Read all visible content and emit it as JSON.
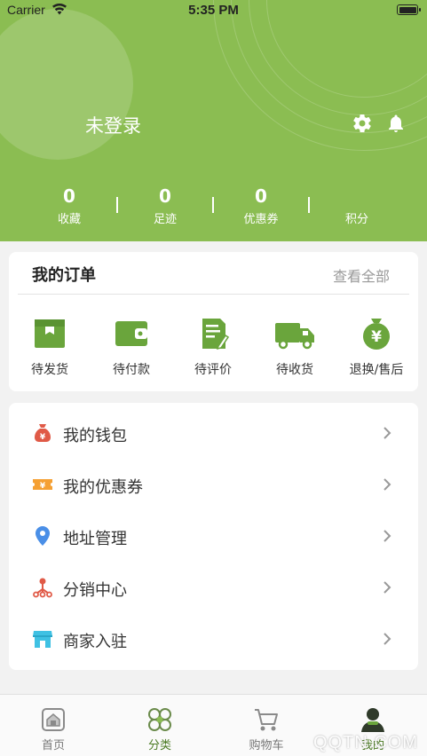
{
  "status_bar": {
    "carrier": "Carrier",
    "time": "5:35 PM"
  },
  "header": {
    "user_name": "未登录",
    "stats": [
      {
        "value": "0",
        "label": "收藏"
      },
      {
        "value": "0",
        "label": "足迹"
      },
      {
        "value": "0",
        "label": "优惠券"
      },
      {
        "value": "",
        "label": "积分"
      }
    ]
  },
  "orders": {
    "title": "我的订单",
    "view_all": "查看全部",
    "items": [
      {
        "label": "待发货",
        "icon": "box-icon"
      },
      {
        "label": "待付款",
        "icon": "wallet-icon"
      },
      {
        "label": "待评价",
        "icon": "review-icon"
      },
      {
        "label": "待收货",
        "icon": "truck-icon"
      },
      {
        "label": "退换/售后",
        "icon": "yen-bag-icon"
      }
    ]
  },
  "menu": {
    "items": [
      {
        "label": "我的钱包",
        "icon": "money-bag-icon"
      },
      {
        "label": "我的优惠券",
        "icon": "coupon-icon"
      },
      {
        "label": "地址管理",
        "icon": "location-pin-icon"
      },
      {
        "label": "分销中心",
        "icon": "distribution-icon"
      },
      {
        "label": "商家入驻",
        "icon": "store-icon"
      }
    ]
  },
  "tabbar": {
    "items": [
      {
        "label": "首页",
        "icon": "home-icon"
      },
      {
        "label": "分类",
        "icon": "category-icon"
      },
      {
        "label": "购物车",
        "icon": "cart-icon"
      },
      {
        "label": "我的",
        "icon": "profile-icon"
      }
    ]
  },
  "watermark": "QQTN.COM",
  "colors": {
    "brand_green": "#8bbd52",
    "order_icon_green": "#6aa53c",
    "wallet_red": "#e05a47",
    "coupon_orange": "#f5a033",
    "pin_blue": "#4a8fe7",
    "store_cyan": "#3fc1e3",
    "tab_active": "#4a7a22",
    "tab_inactive": "#777777"
  }
}
